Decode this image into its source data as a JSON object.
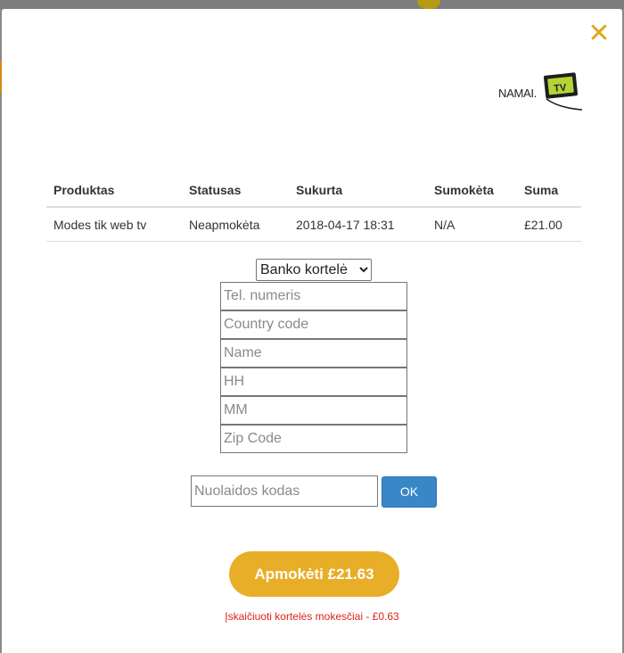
{
  "close_icon": "close-icon",
  "logo": {
    "text": "NAMAI.",
    "badge": "TV"
  },
  "table": {
    "headers": [
      "Produktas",
      "Statusas",
      "Sukurta",
      "Sumokėta",
      "Suma"
    ],
    "rows": [
      [
        "Modes tik web tv",
        "Neapmokėta",
        "2018-04-17 18:31",
        "N/A",
        "£21.00"
      ]
    ]
  },
  "payment": {
    "method_selected": "Banko kortelė",
    "fields": {
      "phone_placeholder": "Tel. numeris",
      "country_placeholder": "Country code",
      "name_placeholder": "Name",
      "hh_placeholder": "HH",
      "mm_placeholder": "MM",
      "zip_placeholder": "Zip Code"
    }
  },
  "coupon": {
    "placeholder": "Nuolaidos kodas",
    "button": "OK"
  },
  "pay_button": "Apmokėti £21.63",
  "fee_note": "Įskaičiuoti kortelės mokesčiai - £0.63",
  "colors": {
    "accent": "#e8ae27",
    "ok_button": "#3a87c8",
    "fee_text": "#d9241c",
    "logo_green": "#b5d334"
  }
}
